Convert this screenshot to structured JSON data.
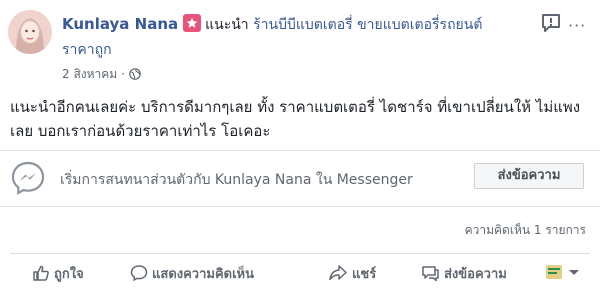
{
  "post": {
    "author": "Kunlaya Nana",
    "recommend_text": "แนะนำ",
    "page_name_line1": "ร้านบีบีแบตเตอรี่ ขายแบตเตอรี่รถยนต์",
    "page_name_line2": "ราคาถูก",
    "date": "2 สิงหาคม",
    "dot": "·",
    "body": "แนะนำอีกคนเลยค่ะ บริการดีมากๆเลย ทั้ง ราคาแบตเตอรี่ ไดชาร์จ ที่เขาเปลี่ยนให้ ไม่แพงเลย บอกเราก่อนด้วยราคาเท่าไร โอเคอะ",
    "more": "···",
    "badge_color": "#e9547a",
    "link_color": "#385898"
  },
  "messenger": {
    "text": "เริ่มการสนทนาส่วนตัวกับ Kunlaya Nana ใน Messenger",
    "button": "ส่งข้อความ"
  },
  "comments": {
    "count_text": "ความคิดเห็น 1 รายการ"
  },
  "actions": {
    "like": "ถูกใจ",
    "comment": "แสดงความคิดเห็น",
    "share": "แชร์",
    "send": "ส่งข้อความ"
  }
}
